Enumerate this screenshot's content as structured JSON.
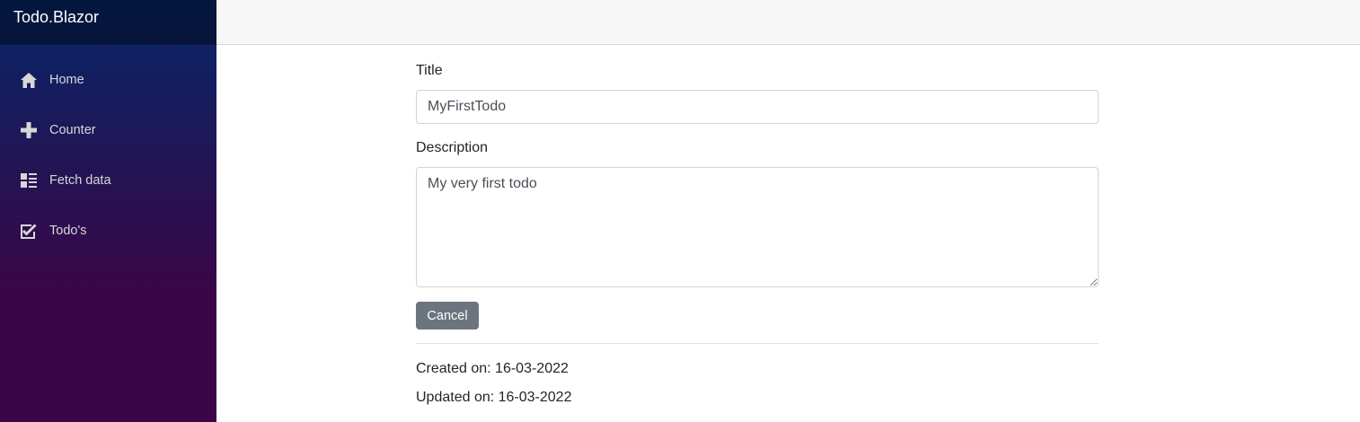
{
  "sidebar": {
    "brand": "Todo.Blazor",
    "items": [
      {
        "label": "Home",
        "icon": "home-icon"
      },
      {
        "label": "Counter",
        "icon": "plus-icon"
      },
      {
        "label": "Fetch data",
        "icon": "list-rich-icon"
      },
      {
        "label": "Todo's",
        "icon": "task-check-icon"
      }
    ]
  },
  "form": {
    "title_label": "Title",
    "title_value": "MyFirstTodo",
    "description_label": "Description",
    "description_value": "My very first todo",
    "cancel_label": "Cancel"
  },
  "meta": {
    "created": "Created on: 16-03-2022",
    "updated": "Updated on: 16-03-2022"
  },
  "colors": {
    "sidebar_gradient_top": "#052767",
    "sidebar_gradient_bottom": "#3a0647",
    "cancel_button": "#6c757d",
    "topbar": "#f7f7f7"
  }
}
